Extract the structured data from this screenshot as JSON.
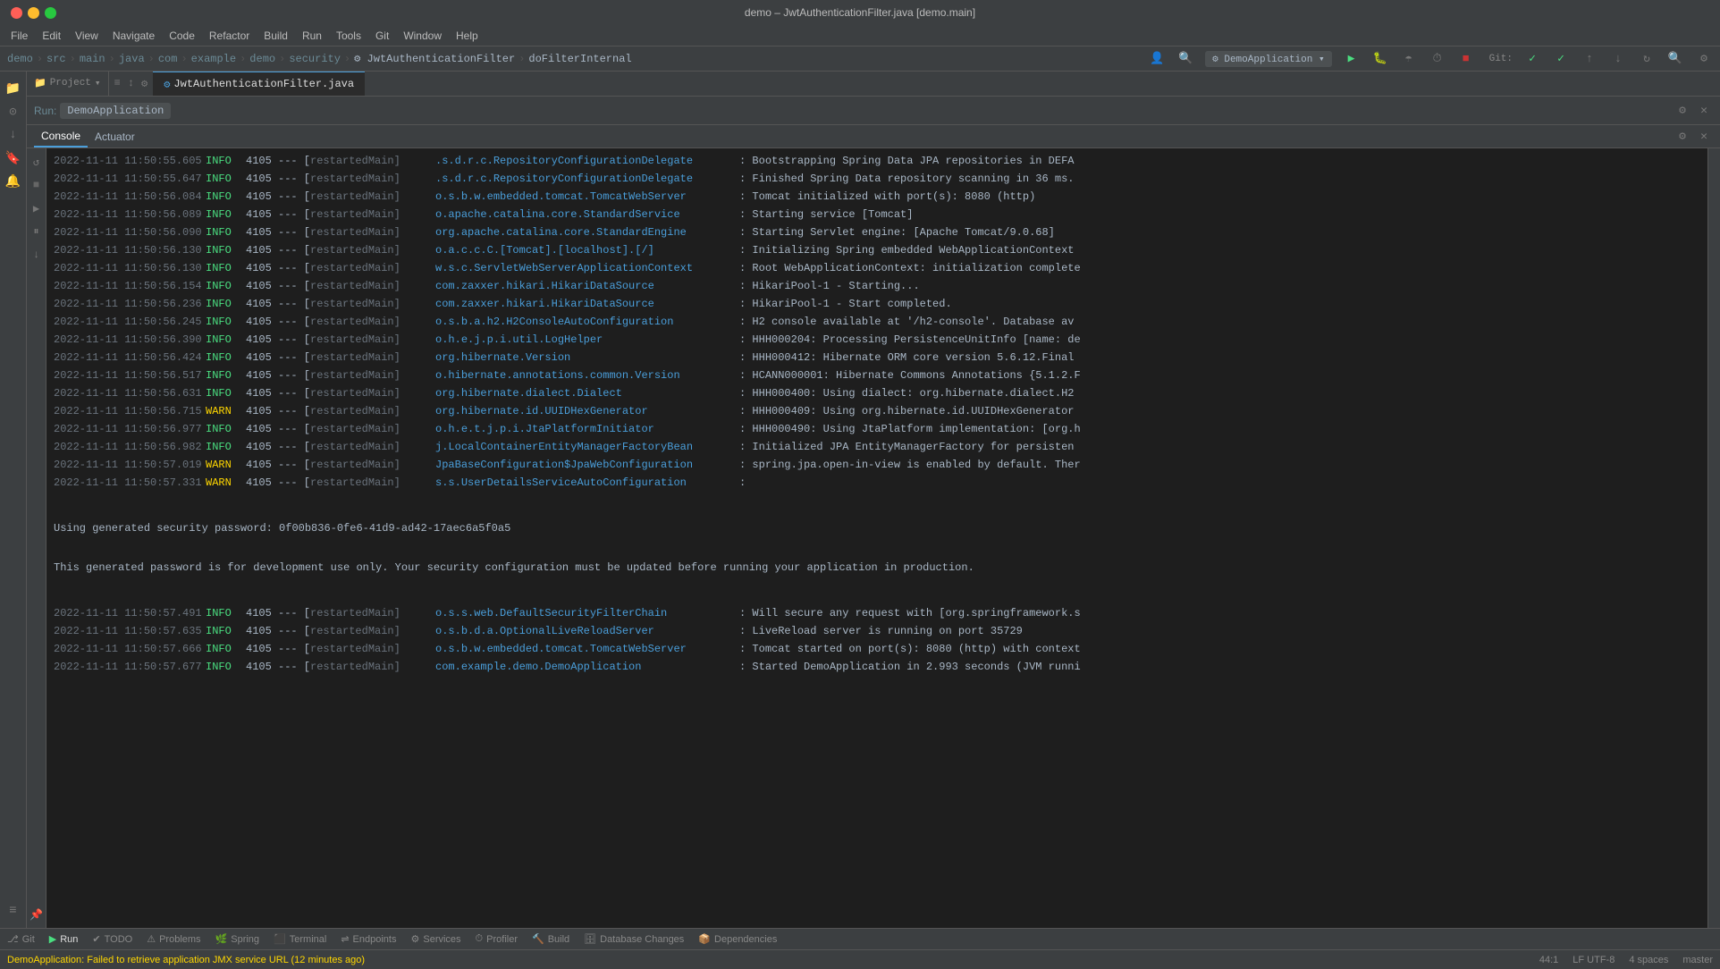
{
  "titleBar": {
    "title": "demo – JwtAuthenticationFilter.java [demo.main]"
  },
  "menuBar": {
    "items": [
      "File",
      "Edit",
      "View",
      "Navigate",
      "Code",
      "Refactor",
      "Build",
      "Run",
      "Tools",
      "Git",
      "Window",
      "Help"
    ]
  },
  "navBar": {
    "crumbs": [
      "demo",
      "src",
      "main",
      "java",
      "com",
      "example",
      "demo",
      "security"
    ],
    "activeFile1": "JwtAuthenticationFilter",
    "activeFile2": "doFilterInternal"
  },
  "editorTabs": [
    {
      "label": "JwtAuthenticationFilter.java",
      "active": true
    },
    {
      "label": "doFilterInternal",
      "active": false
    }
  ],
  "runPanel": {
    "runLabel": "Run:",
    "appName": "DemoApplication",
    "tabs": [
      {
        "label": "Console",
        "active": true
      },
      {
        "label": "Actuator",
        "active": false
      }
    ]
  },
  "consoleLines": [
    {
      "timestamp": "2022-11-11 11:50:55.605",
      "level": "INFO",
      "pid": "4105",
      "thread": "restartedMain",
      "class": ".s.d.r.c.RepositoryConfigurationDelegate",
      "message": ": Bootstrapping Spring Data JPA repositories in DEFA"
    },
    {
      "timestamp": "2022-11-11 11:50:55.647",
      "level": "INFO",
      "pid": "4105",
      "thread": "restartedMain",
      "class": ".s.d.r.c.RepositoryConfigurationDelegate",
      "message": ": Finished Spring Data repository scanning in 36 ms."
    },
    {
      "timestamp": "2022-11-11 11:50:56.084",
      "level": "INFO",
      "pid": "4105",
      "thread": "restartedMain",
      "class": "o.s.b.w.embedded.tomcat.TomcatWebServer",
      "message": ": Tomcat initialized with port(s): 8080 (http)"
    },
    {
      "timestamp": "2022-11-11 11:50:56.089",
      "level": "INFO",
      "pid": "4105",
      "thread": "restartedMain",
      "class": "o.apache.catalina.core.StandardService",
      "message": ": Starting service [Tomcat]"
    },
    {
      "timestamp": "2022-11-11 11:50:56.090",
      "level": "INFO",
      "pid": "4105",
      "thread": "restartedMain",
      "class": "org.apache.catalina.core.StandardEngine",
      "message": ": Starting Servlet engine: [Apache Tomcat/9.0.68]"
    },
    {
      "timestamp": "2022-11-11 11:50:56.130",
      "level": "INFO",
      "pid": "4105",
      "thread": "restartedMain",
      "class": "o.a.c.c.C.[Tomcat].[localhost].[/]",
      "message": ": Initializing Spring embedded WebApplicationContext"
    },
    {
      "timestamp": "2022-11-11 11:50:56.130",
      "level": "INFO",
      "pid": "4105",
      "thread": "restartedMain",
      "class": "w.s.c.ServletWebServerApplicationContext",
      "message": ": Root WebApplicationContext: initialization complete"
    },
    {
      "timestamp": "2022-11-11 11:50:56.154",
      "level": "INFO",
      "pid": "4105",
      "thread": "restartedMain",
      "class": "com.zaxxer.hikari.HikariDataSource",
      "message": ": HikariPool-1 - Starting..."
    },
    {
      "timestamp": "2022-11-11 11:50:56.236",
      "level": "INFO",
      "pid": "4105",
      "thread": "restartedMain",
      "class": "com.zaxxer.hikari.HikariDataSource",
      "message": ": HikariPool-1 - Start completed."
    },
    {
      "timestamp": "2022-11-11 11:50:56.245",
      "level": "INFO",
      "pid": "4105",
      "thread": "restartedMain",
      "class": "o.s.b.a.h2.H2ConsoleAutoConfiguration",
      "message": ": H2 console available at '/h2-console'. Database av"
    },
    {
      "timestamp": "2022-11-11 11:50:56.390",
      "level": "INFO",
      "pid": "4105",
      "thread": "restartedMain",
      "class": "o.h.e.j.p.i.util.LogHelper",
      "message": ": HHH000204: Processing PersistenceUnitInfo [name: de"
    },
    {
      "timestamp": "2022-11-11 11:50:56.424",
      "level": "INFO",
      "pid": "4105",
      "thread": "restartedMain",
      "class": "org.hibernate.Version",
      "message": ": HHH000412: Hibernate ORM core version 5.6.12.Final"
    },
    {
      "timestamp": "2022-11-11 11:50:56.517",
      "level": "INFO",
      "pid": "4105",
      "thread": "restartedMain",
      "class": "o.hibernate.annotations.common.Version",
      "message": ": HCANN000001: Hibernate Commons Annotations {5.1.2.F"
    },
    {
      "timestamp": "2022-11-11 11:50:56.631",
      "level": "INFO",
      "pid": "4105",
      "thread": "restartedMain",
      "class": "org.hibernate.dialect.Dialect",
      "message": ": HHH000400: Using dialect: org.hibernate.dialect.H2"
    },
    {
      "timestamp": "2022-11-11 11:50:56.715",
      "level": "WARN",
      "pid": "4105",
      "thread": "restartedMain",
      "class": "org.hibernate.id.UUIDHexGenerator",
      "message": ": HHH000409: Using org.hibernate.id.UUIDHexGenerator"
    },
    {
      "timestamp": "2022-11-11 11:50:56.977",
      "level": "INFO",
      "pid": "4105",
      "thread": "restartedMain",
      "class": "o.h.e.t.j.p.i.JtaPlatformInitiator",
      "message": ": HHH000490: Using JtaPlatform implementation: [org.h"
    },
    {
      "timestamp": "2022-11-11 11:50:56.982",
      "level": "INFO",
      "pid": "4105",
      "thread": "restartedMain",
      "class": "j.LocalContainerEntityManagerFactoryBean",
      "message": ": Initialized JPA EntityManagerFactory for persisten"
    },
    {
      "timestamp": "2022-11-11 11:50:57.019",
      "level": "WARN",
      "pid": "4105",
      "thread": "restartedMain",
      "class": "JpaBaseConfiguration$JpaWebConfiguration",
      "message": ": spring.jpa.open-in-view is enabled by default. Ther"
    },
    {
      "timestamp": "2022-11-11 11:50:57.331",
      "level": "WARN",
      "pid": "4105",
      "thread": "restartedMain",
      "class": "s.s.UserDetailsServiceAutoConfiguration",
      "message": ":"
    }
  ],
  "securityBlock": {
    "blank1": "",
    "passwordLine": "Using generated security password: 0f00b836-0fe6-41d9-ad42-17aec6a5f0a5",
    "blank2": "",
    "devOnlyLine": "This generated password is for development use only. Your security configuration must be updated before running your application in production.",
    "blank3": ""
  },
  "consoleLinesAfter": [
    {
      "timestamp": "2022-11-11 11:50:57.491",
      "level": "INFO",
      "pid": "4105",
      "thread": "restartedMain",
      "class": "o.s.s.web.DefaultSecurityFilterChain",
      "message": ": Will secure any request with [org.springframework.s"
    },
    {
      "timestamp": "2022-11-11 11:50:57.635",
      "level": "INFO",
      "pid": "4105",
      "thread": "restartedMain",
      "class": "o.s.b.d.a.OptionalLiveReloadServer",
      "message": ": LiveReload server is running on port 35729"
    },
    {
      "timestamp": "2022-11-11 11:50:57.666",
      "level": "INFO",
      "pid": "4105",
      "thread": "restartedMain",
      "class": "o.s.b.w.embedded.tomcat.TomcatWebServer",
      "message": ": Tomcat started on port(s): 8080 (http) with context"
    },
    {
      "timestamp": "2022-11-11 11:50:57.677",
      "level": "INFO",
      "pid": "4105",
      "thread": "restartedMain",
      "class": "com.example.demo.DemoApplication",
      "message": ": Started DemoApplication in 2.993 seconds (JVM runni"
    }
  ],
  "bottomBar": {
    "items": [
      {
        "label": "Git",
        "icon": "git"
      },
      {
        "label": "Run",
        "icon": "play",
        "active": true
      },
      {
        "label": "TODO",
        "icon": "check"
      },
      {
        "label": "Problems",
        "icon": "warning"
      },
      {
        "label": "Spring",
        "icon": "spring"
      },
      {
        "label": "Terminal",
        "icon": "terminal"
      },
      {
        "label": "Endpoints",
        "icon": "endpoints"
      },
      {
        "label": "Services",
        "icon": "services"
      },
      {
        "label": "Profiler",
        "icon": "profiler"
      },
      {
        "label": "Build",
        "icon": "build"
      },
      {
        "label": "Database Changes",
        "icon": "db"
      },
      {
        "label": "Dependencies",
        "icon": "deps"
      }
    ]
  },
  "statusBar": {
    "position": "44:1",
    "encoding": "LF  UTF-8",
    "spaces": "4 spaces",
    "branch": "master",
    "warningMsg": "DemoApplication: Failed to retrieve application JMX service URL (12 minutes ago)"
  }
}
